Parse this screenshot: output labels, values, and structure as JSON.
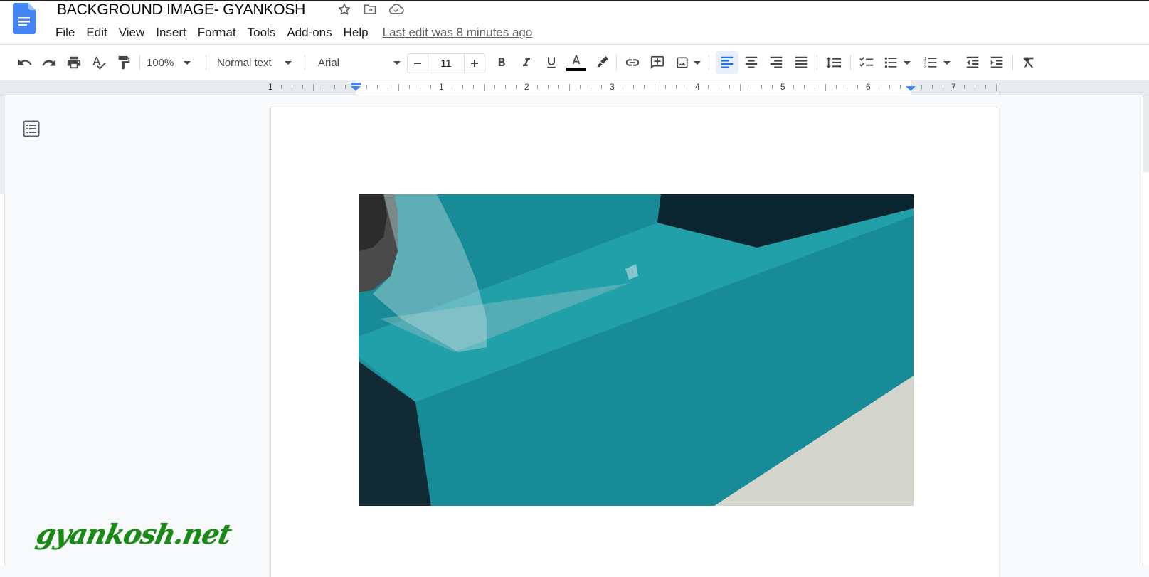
{
  "document": {
    "title": "BACKGROUND IMAGE- GYANKOSH",
    "title_icons": [
      "star-icon",
      "move-to-folder-icon",
      "cloud-saved-icon"
    ],
    "last_edit": "Last edit was 8 minutes ago"
  },
  "menu": [
    {
      "label": "File"
    },
    {
      "label": "Edit"
    },
    {
      "label": "View"
    },
    {
      "label": "Insert"
    },
    {
      "label": "Format"
    },
    {
      "label": "Tools"
    },
    {
      "label": "Add-ons"
    },
    {
      "label": "Help"
    }
  ],
  "toolbar": {
    "zoom": "100%",
    "style": "Normal text",
    "font": "Arial",
    "font_size": "11",
    "text_color": "#000000",
    "alignment_active": "left",
    "buttons": [
      "undo",
      "redo",
      "print",
      "spelling-grammar",
      "paint-format",
      "decrease-font-size",
      "increase-font-size",
      "bold",
      "italic",
      "underline",
      "text-color",
      "highlight",
      "insert-link",
      "add-comment",
      "insert-image",
      "align-left",
      "align-center",
      "align-right",
      "justify",
      "line-spacing",
      "checklist",
      "bulleted-list",
      "numbered-list",
      "decrease-indent",
      "increase-indent",
      "clear-formatting"
    ]
  },
  "ruler": {
    "labels": [
      "1",
      "1",
      "2",
      "3",
      "4",
      "5",
      "6",
      "7"
    ]
  },
  "colors": {
    "docs_blue": "#4285f4",
    "active_bg": "#e8f0fe",
    "active_fg": "#1a73e8",
    "image_teal": "#1a8d99",
    "watermark_green": "#1a8a16"
  },
  "watermark": "gyankosh.net"
}
